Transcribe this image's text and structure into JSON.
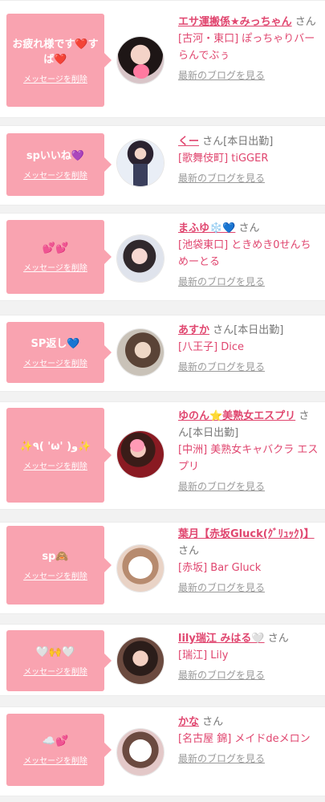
{
  "common": {
    "delete_label": "メッセージを削除",
    "blog_label": "最新のブログを見る",
    "suffix": "さん"
  },
  "items": [
    {
      "message": "お疲れ様です❤️すば❤️",
      "name": "エサ運搬係★みっちゃん",
      "status": "",
      "shop": "[古河・東口] ぽっちゃりバー らんでぶぅ"
    },
    {
      "message": "spいいね💜",
      "name": "くー",
      "status": "[本日出勤]",
      "shop": "[歌舞伎町] tiGGER"
    },
    {
      "message": "💕💕",
      "name": "まふゆ❄️💙",
      "status": "",
      "shop": "[池袋東口] ときめき0せんちめーとる"
    },
    {
      "message": "SP返し💙",
      "name": "あすか",
      "status": "[本日出勤]",
      "shop": "[八王子] Dice"
    },
    {
      "message": "✨٩( 'ω' )و✨",
      "name": "ゆのん⭐美熟女エスプリ",
      "status": "[本日出勤]",
      "shop": "[中洲] 美熟女キャバクラ エスプリ"
    },
    {
      "message": "sp🙈",
      "name": "葉月【赤坂Gluck(ｸﾞﾘｭｯｸ)】",
      "status": "",
      "shop": "[赤坂] Bar Gluck"
    },
    {
      "message": "🤍🙌🤍",
      "name": "lily瑞江 みはる🤍",
      "status": "",
      "shop": "[瑞江] Lily"
    },
    {
      "message": "☁️💕",
      "name": "かな",
      "status": "",
      "shop": "[名古屋 錦] メイドdeメロン"
    }
  ],
  "colors": {
    "accent": "#e0466f",
    "bubble": "#f9a3b0"
  }
}
